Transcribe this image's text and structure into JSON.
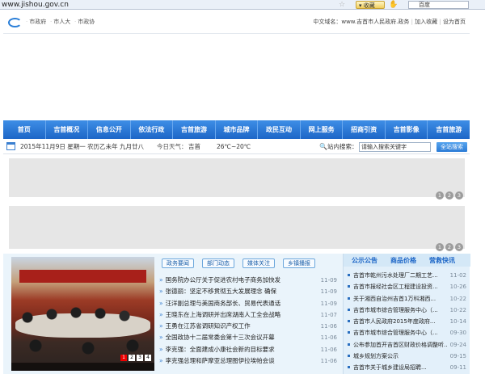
{
  "browser": {
    "url": "www.jishou.gov.cn",
    "favorites_label": "收藏",
    "search_engine": "百度"
  },
  "topbar": {
    "links": [
      "市政府",
      "市人大",
      "市政协"
    ],
    "right_text": "中文域名：www.吉首市人民政府.政务",
    "add_fav": "加入收藏",
    "set_home": "设为首页"
  },
  "nav": {
    "items": [
      "首页",
      "吉首概况",
      "信息公开",
      "依法行政",
      "吉首旅游",
      "城市品牌",
      "政民互动",
      "网上服务",
      "招商引资",
      "吉首影像",
      "吉首旅游"
    ]
  },
  "info": {
    "date": "2015年11月9日 星期一 农历乙未年 九月廿八",
    "weather_label": "今日天气：",
    "weather_place": "吉首",
    "weather_temp": "26℃~20℃",
    "search_label": "站内搜索：",
    "search_placeholder": "请输入搜索关键字",
    "search_button": "全站搜索"
  },
  "panels": {
    "pager": [
      "1",
      "2",
      "3"
    ]
  },
  "photo": {
    "dots": [
      "1",
      "2",
      "3",
      "4"
    ]
  },
  "news": {
    "tabs": [
      "政务要闻",
      "部门动态",
      "媒体关注",
      "乡镇播报"
    ],
    "items": [
      {
        "title": "国务院办公厅关于促进农村电子商务加快发",
        "date": "11-09"
      },
      {
        "title": "张德丽：坚定不移贯彻五大发展理念 确保",
        "date": "11-09"
      },
      {
        "title": "汪洋副总理与美国商务部长、贸易代表通话",
        "date": "11-09"
      },
      {
        "title": "王晓东在上海调研并出席湖南人工全会战略",
        "date": "11-07"
      },
      {
        "title": "王勇在江苏省调研知识产权工作",
        "date": "11-06"
      },
      {
        "title": "全国政协十二届常委会第十三次会议开幕",
        "date": "11-06"
      },
      {
        "title": "李克强：全面建成小康社会新的目标要求",
        "date": "11-06"
      },
      {
        "title": "李克强总理和萨摩亚总理图伊拉埃帕会谈",
        "date": "11-06"
      }
    ]
  },
  "right": {
    "tabs": [
      "公示公告",
      "商品价格",
      "营救快讯"
    ],
    "items": [
      {
        "title": "吉首市乾州污水处理厂二期工艺...",
        "date": "11-02"
      },
      {
        "title": "吉首市报经社会区工程建设投资...",
        "date": "10-26"
      },
      {
        "title": "关于湘西自治州吉首1万科湘西...",
        "date": "10-22"
      },
      {
        "title": "吉首市城市综合管理服务中心（...",
        "date": "10-22"
      },
      {
        "title": "吉首市人民政府2015年度政府...",
        "date": "10-14"
      },
      {
        "title": "吉首市城市综合管理服务中心（...",
        "date": "09-30"
      },
      {
        "title": "公布参加首开吉首区财政价格调整听...",
        "date": "09-24"
      },
      {
        "title": "城乡规划方案公示",
        "date": "09-15"
      },
      {
        "title": "吉首市关于城乡建设局招聘...",
        "date": "09-11"
      }
    ]
  }
}
